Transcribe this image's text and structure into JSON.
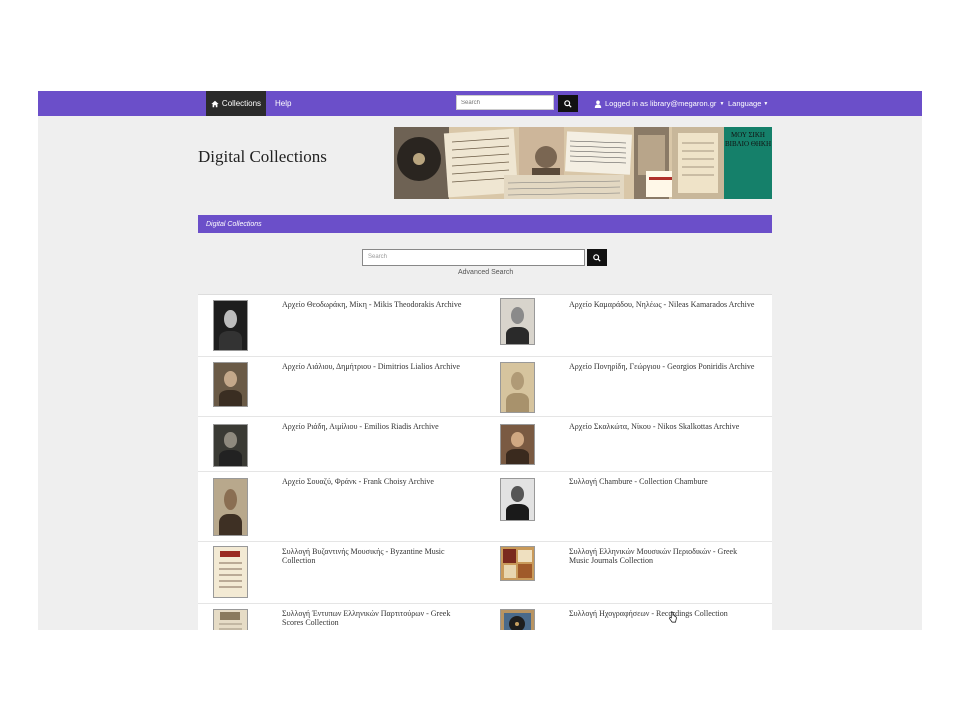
{
  "nav": {
    "collections_label": "Collections",
    "help_label": "Help",
    "search_placeholder": "Search",
    "user_label": "Logged in as library@megaron.gr",
    "language_label": "Language"
  },
  "header": {
    "title": "Digital Collections",
    "banner_text": "ΜΟΥ ΣΙΚΗ ΒΙΒΛΙΟ ΘΗΚΗ"
  },
  "section": {
    "title": "Digital Collections"
  },
  "search": {
    "placeholder": "Search",
    "advanced_label": "Advanced Search"
  },
  "collections": [
    {
      "label": "Αρχείο Θεοδωράκη, Μίκη - Mikis Theodorakis Archive"
    },
    {
      "label": "Αρχείο Καμαράδου, Νηλέως - Nileas Kamarados Archive"
    },
    {
      "label": "Αρχείο Λιάλιου, Δημήτριου - Dimitrios Lialios Archive"
    },
    {
      "label": "Αρχείο Πονηρίδη, Γεώργιου - Georgios Poniridis Archive"
    },
    {
      "label": "Αρχείο Ριάδη, Αιμίλιου - Emilios Riadis Archive"
    },
    {
      "label": "Αρχείο Σκαλκώτα, Νίκου - Nikos Skalkottas Archive"
    },
    {
      "label": "Αρχείο Σουαζύ, Φράνκ - Frank Choisy Archive"
    },
    {
      "label": "Συλλογή Chambure - Collection Chambure"
    },
    {
      "label": "Συλλογή Βυζαντινής Μουσικής - Byzantine Music Collection"
    },
    {
      "label": "Συλλογή Ελληνικών Μουσικών Περιοδικών - Greek Music Journals Collection"
    },
    {
      "label": "Συλλογή Έντυπων Ελληνικών Παρτιτούρων - Greek Scores Collection"
    },
    {
      "label": "Συλλογή Ηχογραφήσεων - Recordings Collection"
    }
  ],
  "colors": {
    "accent": "#6b4fc9",
    "nav_active": "#2b2b2b",
    "banner_green": "#15806a"
  }
}
